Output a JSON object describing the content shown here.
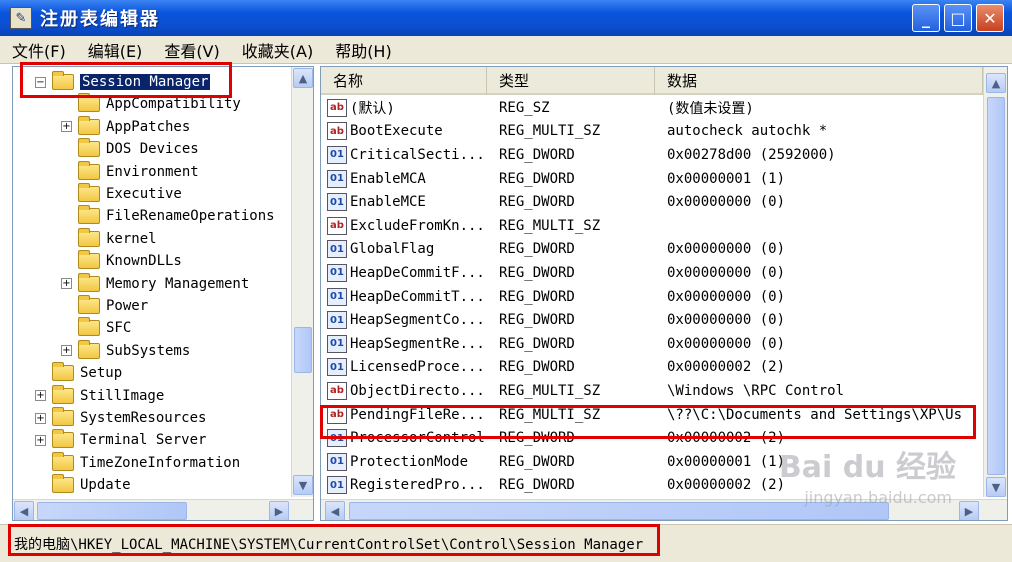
{
  "window": {
    "title": "注册表编辑器",
    "minimize": "_",
    "maximize": "□",
    "close": "✕"
  },
  "menu": [
    "文件(F)",
    "编辑(E)",
    "查看(V)",
    "收藏夹(A)",
    "帮助(H)"
  ],
  "tree": {
    "items": [
      {
        "label": "Session Manager",
        "level": 0,
        "expander": "−",
        "selected": true
      },
      {
        "label": "AppCompatibility",
        "level": 1,
        "expander": ""
      },
      {
        "label": "AppPatches",
        "level": 1,
        "expander": "+"
      },
      {
        "label": "DOS Devices",
        "level": 1,
        "expander": ""
      },
      {
        "label": "Environment",
        "level": 1,
        "expander": ""
      },
      {
        "label": "Executive",
        "level": 1,
        "expander": ""
      },
      {
        "label": "FileRenameOperations",
        "level": 1,
        "expander": ""
      },
      {
        "label": "kernel",
        "level": 1,
        "expander": ""
      },
      {
        "label": "KnownDLLs",
        "level": 1,
        "expander": ""
      },
      {
        "label": "Memory Management",
        "level": 1,
        "expander": "+"
      },
      {
        "label": "Power",
        "level": 1,
        "expander": ""
      },
      {
        "label": "SFC",
        "level": 1,
        "expander": ""
      },
      {
        "label": "SubSystems",
        "level": 1,
        "expander": "+"
      },
      {
        "label": "Setup",
        "level": 0,
        "expander": ""
      },
      {
        "label": "StillImage",
        "level": 0,
        "expander": "+"
      },
      {
        "label": "SystemResources",
        "level": 0,
        "expander": "+"
      },
      {
        "label": "Terminal Server",
        "level": 0,
        "expander": "+"
      },
      {
        "label": "TimeZoneInformation",
        "level": 0,
        "expander": ""
      },
      {
        "label": "Update",
        "level": 0,
        "expander": ""
      }
    ]
  },
  "list": {
    "columns": [
      "名称",
      "类型",
      "数据"
    ],
    "rows": [
      {
        "icon": "ab",
        "name": "(默认)",
        "type": "REG_SZ",
        "data": "(数值未设置)"
      },
      {
        "icon": "ab",
        "name": "BootExecute",
        "type": "REG_MULTI_SZ",
        "data": "autocheck autochk *"
      },
      {
        "icon": "01",
        "name": "CriticalSecti...",
        "type": "REG_DWORD",
        "data": "0x00278d00 (2592000)"
      },
      {
        "icon": "01",
        "name": "EnableMCA",
        "type": "REG_DWORD",
        "data": "0x00000001 (1)"
      },
      {
        "icon": "01",
        "name": "EnableMCE",
        "type": "REG_DWORD",
        "data": "0x00000000 (0)"
      },
      {
        "icon": "ab",
        "name": "ExcludeFromKn...",
        "type": "REG_MULTI_SZ",
        "data": ""
      },
      {
        "icon": "01",
        "name": "GlobalFlag",
        "type": "REG_DWORD",
        "data": "0x00000000 (0)"
      },
      {
        "icon": "01",
        "name": "HeapDeCommitF...",
        "type": "REG_DWORD",
        "data": "0x00000000 (0)"
      },
      {
        "icon": "01",
        "name": "HeapDeCommitT...",
        "type": "REG_DWORD",
        "data": "0x00000000 (0)"
      },
      {
        "icon": "01",
        "name": "HeapSegmentCo...",
        "type": "REG_DWORD",
        "data": "0x00000000 (0)"
      },
      {
        "icon": "01",
        "name": "HeapSegmentRe...",
        "type": "REG_DWORD",
        "data": "0x00000000 (0)"
      },
      {
        "icon": "01",
        "name": "LicensedProce...",
        "type": "REG_DWORD",
        "data": "0x00000002 (2)"
      },
      {
        "icon": "ab",
        "name": "ObjectDirecto...",
        "type": "REG_MULTI_SZ",
        "data": "\\Windows \\RPC Control"
      },
      {
        "icon": "ab",
        "name": "PendingFileRe...",
        "type": "REG_MULTI_SZ",
        "data": "\\??\\C:\\Documents and Settings\\XP\\Us"
      },
      {
        "icon": "01",
        "name": "ProcessorControl",
        "type": "REG_DWORD",
        "data": "0x00000002 (2)"
      },
      {
        "icon": "01",
        "name": "ProtectionMode",
        "type": "REG_DWORD",
        "data": "0x00000001 (1)"
      },
      {
        "icon": "01",
        "name": "RegisteredPro...",
        "type": "REG_DWORD",
        "data": "0x00000002 (2)"
      }
    ]
  },
  "scroll": {
    "up": "▲",
    "down": "▼",
    "left": "◀",
    "right": "▶"
  },
  "status": {
    "path": "我的电脑\\HKEY_LOCAL_MACHINE\\SYSTEM\\CurrentControlSet\\Control\\Session Manager"
  },
  "watermark": {
    "main": "Bai du 经验",
    "sub": "jingyan.baidu.com"
  }
}
